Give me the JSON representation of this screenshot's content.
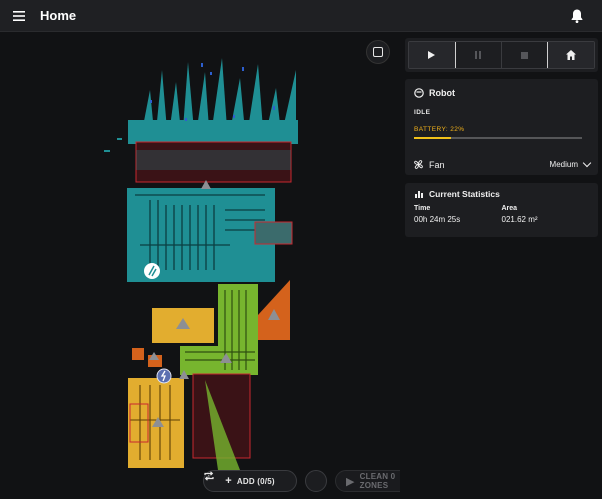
{
  "appbar": {
    "title": "Home",
    "menu_icon": "hamburger-menu-icon",
    "notification_icon": "bell-icon"
  },
  "map_controls": {
    "add_label": "ADD (0/5)",
    "clean_label": "CLEAN 0 ZONES"
  },
  "robot": {
    "title": "Robot",
    "status": "IDLE",
    "battery_label": "BATTERY: 22%",
    "battery_percent": 22,
    "battery_color": "#f2c21a"
  },
  "fan": {
    "label": "Fan",
    "value": "Medium"
  },
  "stats": {
    "title": "Current Statistics",
    "time_label": "Time",
    "time_value": "00h 24m 25s",
    "area_label": "Area",
    "area_value": "021.62 m²"
  },
  "colors": {
    "segment_teal": "#1f8f94",
    "segment_yellow": "#e2ad2f",
    "segment_green": "#77b52e",
    "segment_orange": "#d4621c",
    "zone_red": "#c8282f",
    "no_go_fill": "#3a1216"
  }
}
